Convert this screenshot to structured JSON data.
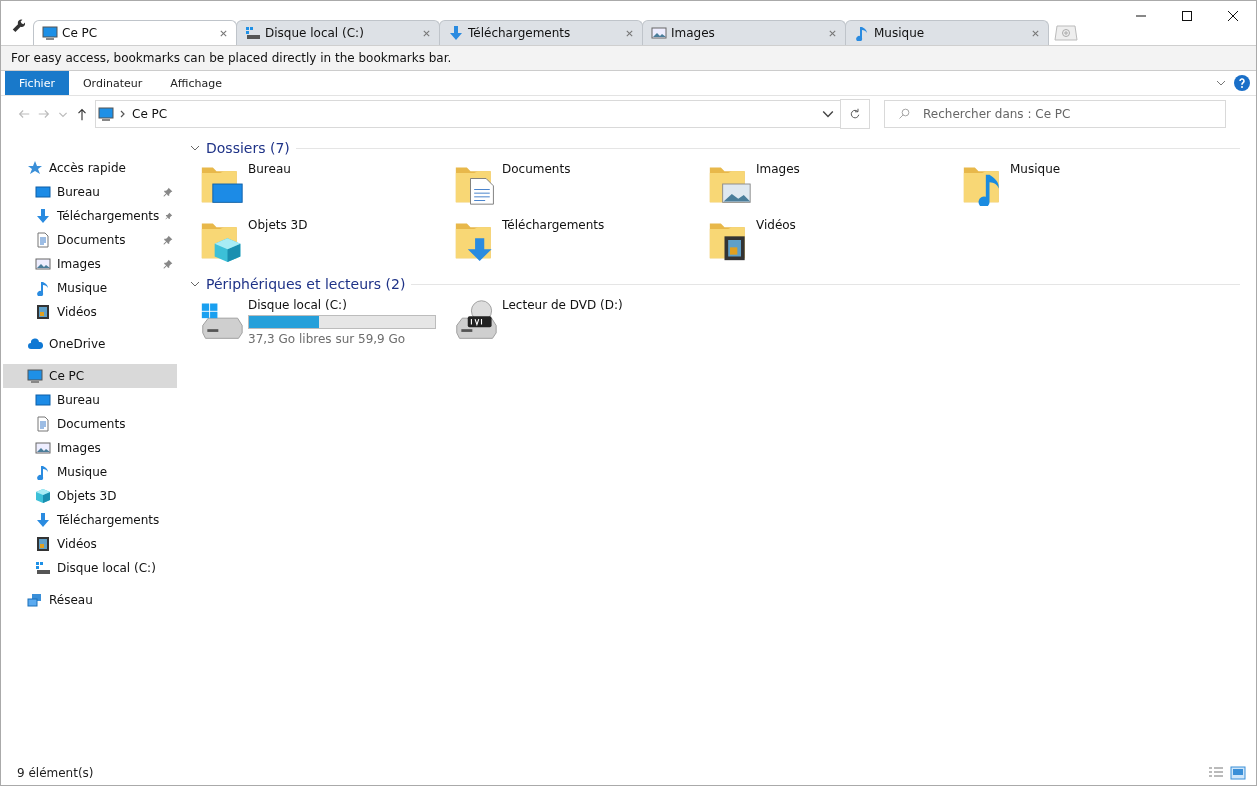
{
  "tabs": [
    {
      "label": "Ce PC",
      "kind": "pc",
      "selected": true
    },
    {
      "label": "Disque local (C:)",
      "kind": "drive",
      "selected": false
    },
    {
      "label": "Téléchargements",
      "kind": "download",
      "selected": false
    },
    {
      "label": "Images",
      "kind": "image",
      "selected": false
    },
    {
      "label": "Musique",
      "kind": "music",
      "selected": false
    }
  ],
  "bookmarks_hint": "For easy access, bookmarks can be placed directly in the bookmarks bar.",
  "ribbon_tabs": [
    {
      "label": "Fichier",
      "selected": true
    },
    {
      "label": "Ordinateur",
      "selected": false
    },
    {
      "label": "Affichage",
      "selected": false
    }
  ],
  "address": {
    "path": "Ce PC"
  },
  "search": {
    "placeholder": "Rechercher dans : Ce PC"
  },
  "sidebar": {
    "items": [
      {
        "label": "Accès rapide",
        "kind": "star",
        "selected": false,
        "children": [
          {
            "label": "Bureau",
            "kind": "desktop",
            "pinned": true,
            "selected": false
          },
          {
            "label": "Téléchargements",
            "kind": "download",
            "pinned": true,
            "selected": false
          },
          {
            "label": "Documents",
            "kind": "document",
            "pinned": true,
            "selected": false
          },
          {
            "label": "Images",
            "kind": "image",
            "pinned": true,
            "selected": false
          },
          {
            "label": "Musique",
            "kind": "music",
            "pinned": false,
            "selected": false
          },
          {
            "label": "Vidéos",
            "kind": "video",
            "pinned": false,
            "selected": false
          }
        ]
      },
      {
        "label": "OneDrive",
        "kind": "cloud",
        "selected": false
      },
      {
        "label": "Ce PC",
        "kind": "pc",
        "selected": true,
        "children": [
          {
            "label": "Bureau",
            "kind": "desktop",
            "selected": false
          },
          {
            "label": "Documents",
            "kind": "document",
            "selected": false
          },
          {
            "label": "Images",
            "kind": "image",
            "selected": false
          },
          {
            "label": "Musique",
            "kind": "music",
            "selected": false
          },
          {
            "label": "Objets 3D",
            "kind": "cube",
            "selected": false
          },
          {
            "label": "Téléchargements",
            "kind": "download",
            "selected": false
          },
          {
            "label": "Vidéos",
            "kind": "video",
            "selected": false
          },
          {
            "label": "Disque local (C:)",
            "kind": "drive",
            "selected": false
          }
        ]
      },
      {
        "label": "Réseau",
        "kind": "network",
        "selected": false
      }
    ]
  },
  "sections": [
    {
      "title": "Dossiers (7)",
      "expanded": true,
      "items": [
        {
          "label": "Bureau",
          "kind": "desktop"
        },
        {
          "label": "Documents",
          "kind": "document"
        },
        {
          "label": "Images",
          "kind": "image"
        },
        {
          "label": "Musique",
          "kind": "music"
        },
        {
          "label": "Objets 3D",
          "kind": "cube"
        },
        {
          "label": "Téléchargements",
          "kind": "download"
        },
        {
          "label": "Vidéos",
          "kind": "video"
        }
      ]
    },
    {
      "title": "Périphériques et lecteurs (2)",
      "expanded": true,
      "items": [
        {
          "label": "Disque local (C:)",
          "kind": "drive",
          "level": 0.377,
          "free": "37,3 Go libres sur 59,9 Go"
        },
        {
          "label": "Lecteur de DVD (D:)",
          "kind": "dvd"
        }
      ]
    }
  ],
  "status_bar": {
    "count": "9 élément(s)"
  }
}
